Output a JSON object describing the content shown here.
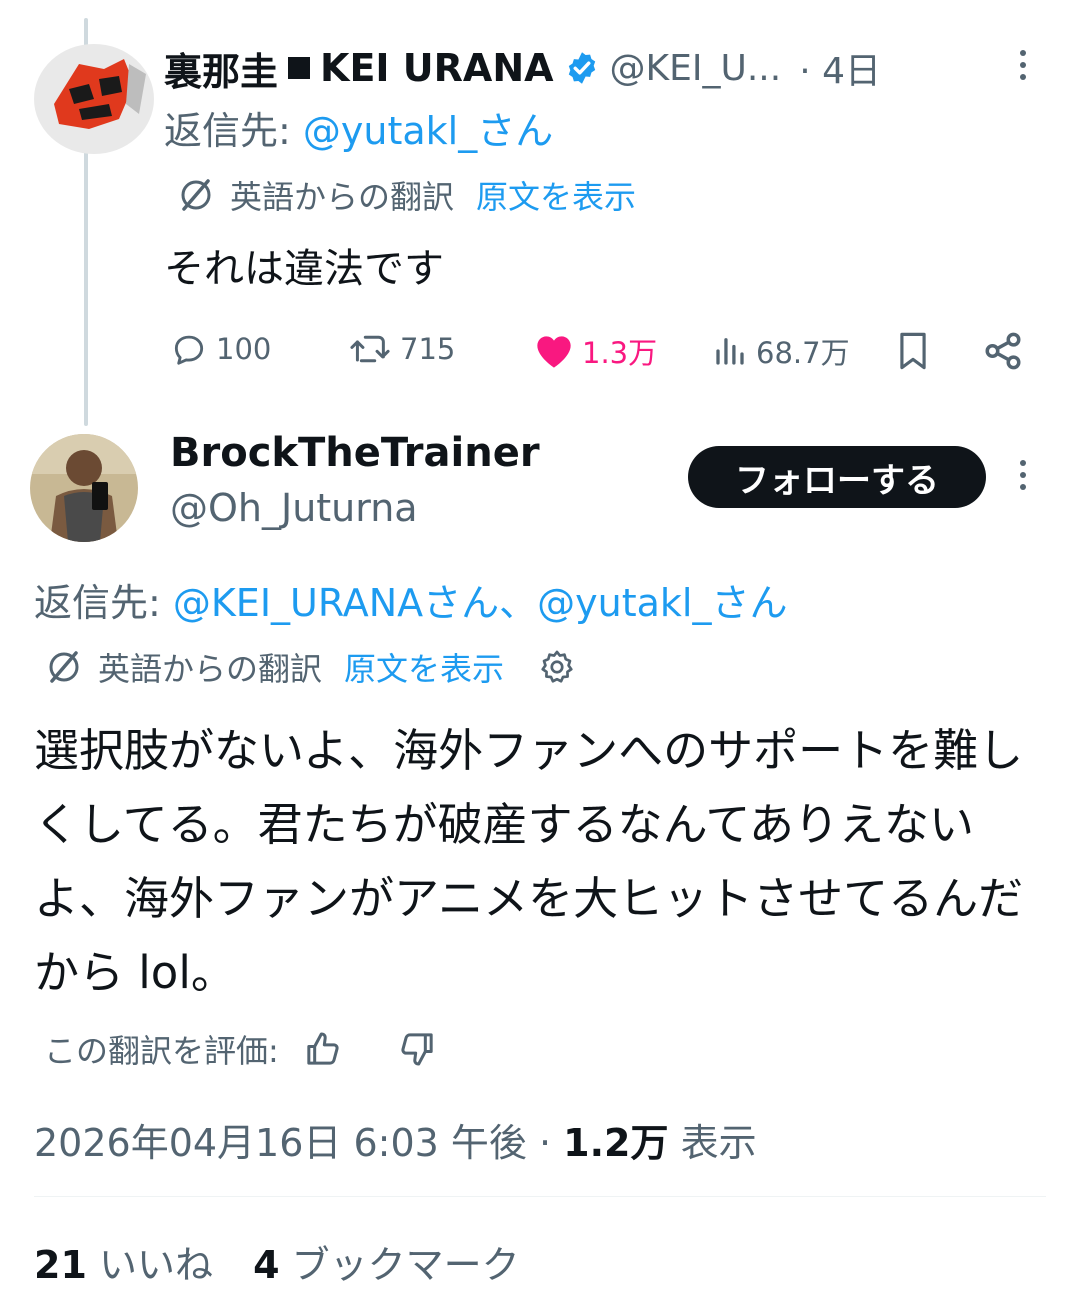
{
  "tweet1": {
    "display_name": "裏那圭",
    "name_suffix": "KEI URANA",
    "handle": "@KEI_U...",
    "time": "· 4日",
    "reply_prefix": "返信先: ",
    "reply_to": "@yutakl_さん",
    "translated_from": "英語からの翻訳",
    "show_original": "原文を表示",
    "text": "それは違法です",
    "stats": {
      "replies": "100",
      "reposts": "715",
      "likes": "1.3万",
      "views": "68.7万"
    },
    "like_color": "#f91880"
  },
  "tweet2": {
    "display_name": "BrockTheTrainer",
    "handle": "@Oh_Juturna",
    "follow_label": "フォローする",
    "reply_prefix": "返信先: ",
    "reply_to": "@KEI_URANAさん、@yutakl_さん",
    "translated_from": "英語からの翻訳",
    "show_original": "原文を表示",
    "text": "選択肢がないよ、海外ファンへのサポートを難しくしてる。君たちが破産するなんてありえないよ、海外ファンがアニメを大ヒットさせてるんだから lol。",
    "rate_translation": "この翻訳を評価:",
    "timestamp": "2026年04月16日 6:03 午後",
    "sep": " · ",
    "views_count": "1.2万",
    "views_label": " 表示",
    "likes_count": "21",
    "likes_label": " いいね",
    "bookmarks_count": "4",
    "bookmarks_label": " ブックマーク"
  },
  "colors": {
    "link": "#1d9bf0",
    "muted": "#536471",
    "verified": "#1d9bf0"
  }
}
